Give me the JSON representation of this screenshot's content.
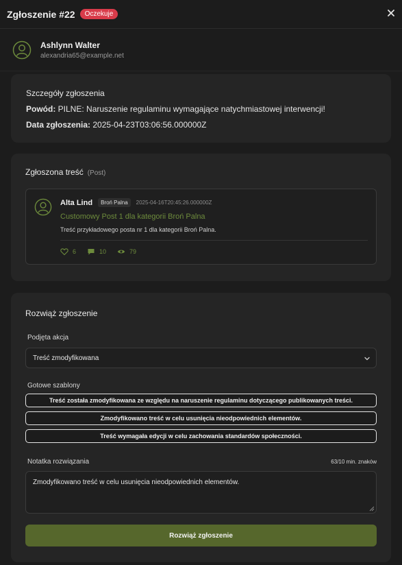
{
  "header": {
    "title": "Zgłoszenie #22",
    "status": "Oczekuje"
  },
  "user": {
    "name": "Ashlynn Walter",
    "email": "alexandria65@example.net"
  },
  "details": {
    "title": "Szczegóły zgłoszenia",
    "reason_label": "Powód:",
    "reason_value": "PILNE: Naruszenie regulaminu wymagające natychmiastowej interwencji!",
    "date_label": "Data zgłoszenia:",
    "date_value": "2025-04-23T03:06:56.000000Z"
  },
  "reported": {
    "title": "Zgłoszona treść",
    "type": "(Post)",
    "post": {
      "author": "Alta Lind",
      "category": "Broń Palna",
      "date": "2025-04-16T20:45:26.000000Z",
      "title": "Customowy Post 1 dla kategorii Broń Palna",
      "excerpt": "Treść przykładowego posta nr 1 dla kategorii Broń Palna.",
      "likes": "6",
      "comments": "10",
      "views": "79"
    }
  },
  "resolve": {
    "title": "Rozwiąż zgłoszenie",
    "action_label": "Podjęta akcja",
    "action_value": "Treść zmodyfikowana",
    "templates_label": "Gotowe szablony",
    "templates": [
      "Treść została zmodyfikowana ze względu na naruszenie regulaminu dotyczącego publikowanych treści.",
      "Zmodyfikowano treść w celu usunięcia nieodpowiednich elementów.",
      "Treść wymagała edycji w celu zachowania standardów społeczności."
    ],
    "note_label": "Notatka rozwiązania",
    "char_count": "63/10 min. znaków",
    "note_value": "Zmodyfikowano treść w celu usunięcia nieodpowiednich elementów.",
    "submit_label": "Rozwiąż zgłoszenie"
  },
  "colors": {
    "accent": "#56672c",
    "link": "#6d8b3c",
    "badge": "#d93b4a"
  }
}
